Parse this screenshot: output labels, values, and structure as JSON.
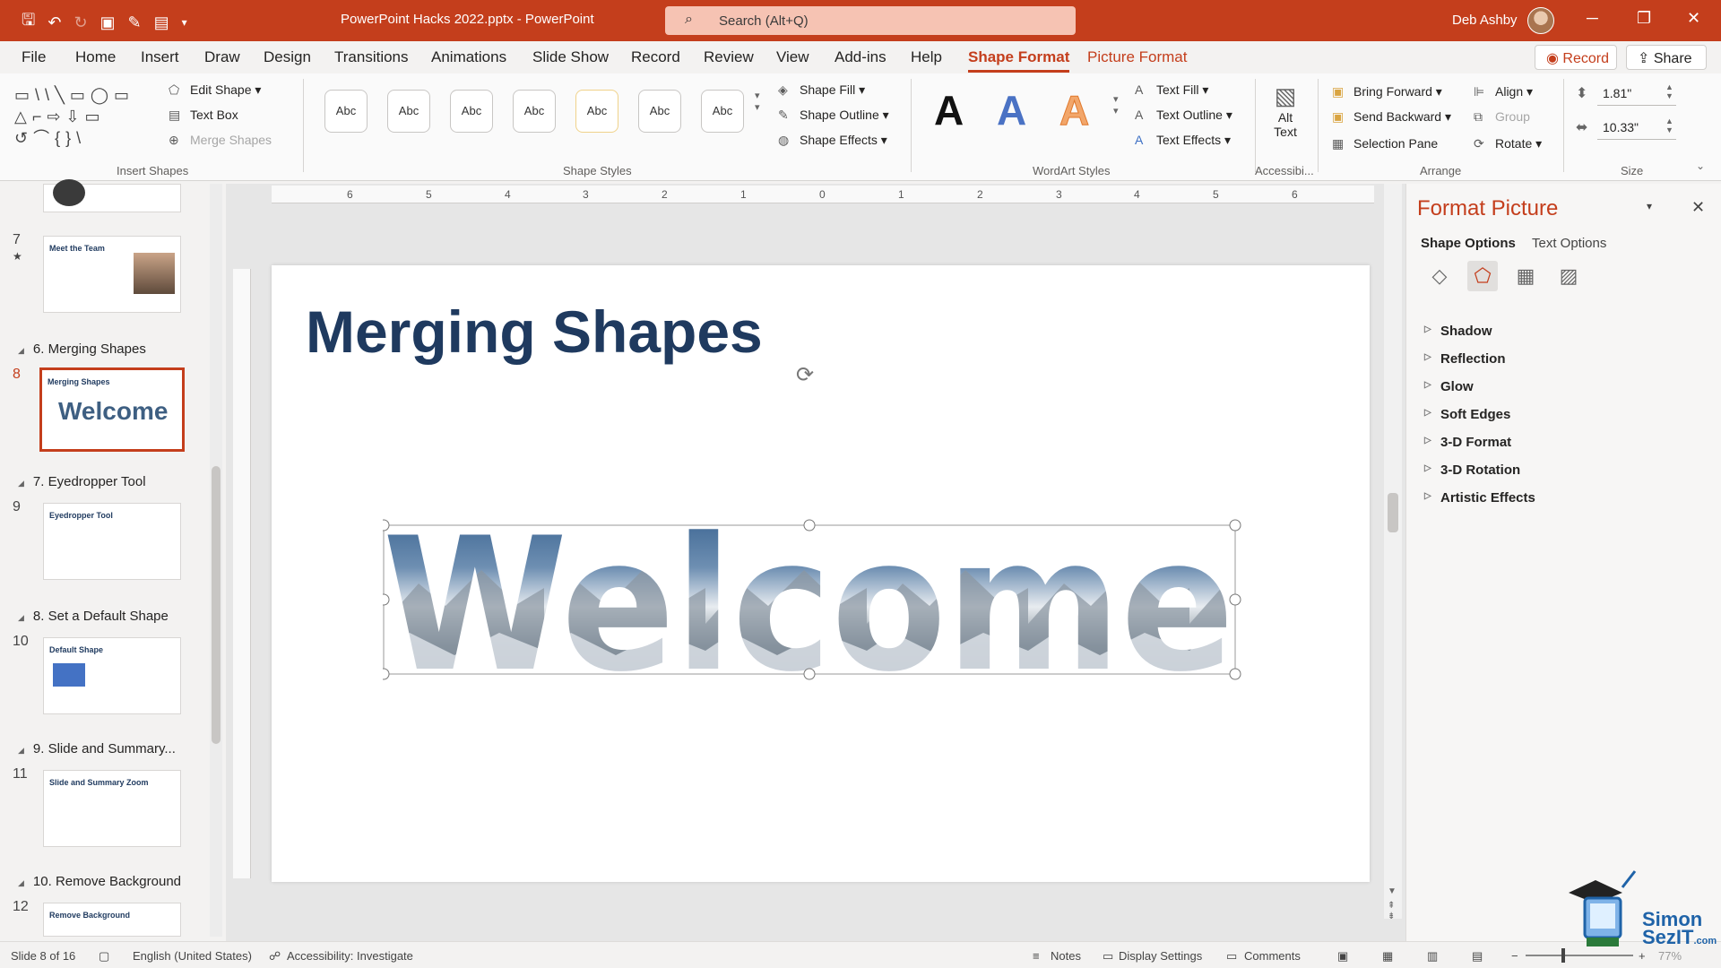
{
  "titlebar": {
    "doc_title": "PowerPoint Hacks 2022.pptx - PowerPoint",
    "search_placeholder": "Search (Alt+Q)",
    "user_name": "Deb Ashby",
    "accent": "#c43e1c"
  },
  "menu": {
    "tabs": [
      "File",
      "Home",
      "Insert",
      "Draw",
      "Design",
      "Transitions",
      "Animations",
      "Slide Show",
      "Record",
      "Review",
      "View",
      "Add-ins",
      "Help",
      "Shape Format",
      "Picture Format"
    ],
    "active": "Shape Format",
    "record": "Record",
    "share": "Share"
  },
  "ribbon": {
    "insert_shapes": {
      "label": "Insert Shapes",
      "edit_shape": "Edit Shape",
      "text_box": "Text Box",
      "merge_shapes": "Merge Shapes"
    },
    "shape_styles": {
      "label": "Shape Styles",
      "abc": [
        "Abc",
        "Abc",
        "Abc",
        "Abc",
        "Abc",
        "Abc",
        "Abc"
      ],
      "shape_fill": "Shape Fill",
      "shape_outline": "Shape Outline",
      "shape_effects": "Shape Effects"
    },
    "wordart": {
      "label": "WordArt Styles",
      "letter": "A",
      "text_fill": "Text Fill",
      "text_outline": "Text Outline",
      "text_effects": "Text Effects"
    },
    "accessibility": {
      "label": "Accessibi...",
      "alt_text_1": "Alt",
      "alt_text_2": "Text"
    },
    "arrange": {
      "label": "Arrange",
      "bring_forward": "Bring Forward",
      "send_backward": "Send Backward",
      "selection_pane": "Selection Pane",
      "align": "Align",
      "group": "Group",
      "rotate": "Rotate"
    },
    "size": {
      "label": "Size",
      "height": "1.81\"",
      "width": "10.33\""
    }
  },
  "thumbnails": [
    {
      "num": "7",
      "title": "Meet the Team"
    },
    {
      "section": "6. Merging Shapes",
      "num": "8",
      "title": "Merging Shapes",
      "sub": "Welcome"
    },
    {
      "section": "7. Eyedropper Tool",
      "num": "9",
      "title": "Eyedropper Tool"
    },
    {
      "section": "8. Set a Default Shape",
      "num": "10",
      "title": "Default Shape"
    },
    {
      "section": "9. Slide and Summary...",
      "num": "11",
      "title": "Slide and Summary Zoom"
    },
    {
      "section": "10. Remove Background",
      "num": "12",
      "title": "Remove Background"
    }
  ],
  "slide": {
    "title": "Merging Shapes",
    "word": "Welcome"
  },
  "format_pane": {
    "title": "Format Picture",
    "tabs": [
      "Shape Options",
      "Text Options"
    ],
    "items": [
      "Shadow",
      "Reflection",
      "Glow",
      "Soft Edges",
      "3-D Format",
      "3-D Rotation",
      "Artistic Effects"
    ]
  },
  "ruler": [
    "6",
    "5",
    "4",
    "3",
    "2",
    "1",
    "0",
    "1",
    "2",
    "3",
    "4",
    "5",
    "6"
  ],
  "statusbar": {
    "slide_of": "Slide 8 of 16",
    "language": "English (United States)",
    "accessibility": "Accessibility: Investigate",
    "notes": "Notes",
    "display_settings": "Display Settings",
    "comments": "Comments",
    "zoom": "77%"
  },
  "logo": {
    "line1": "Simon",
    "line2": "SezIT",
    "suffix": ".com"
  }
}
